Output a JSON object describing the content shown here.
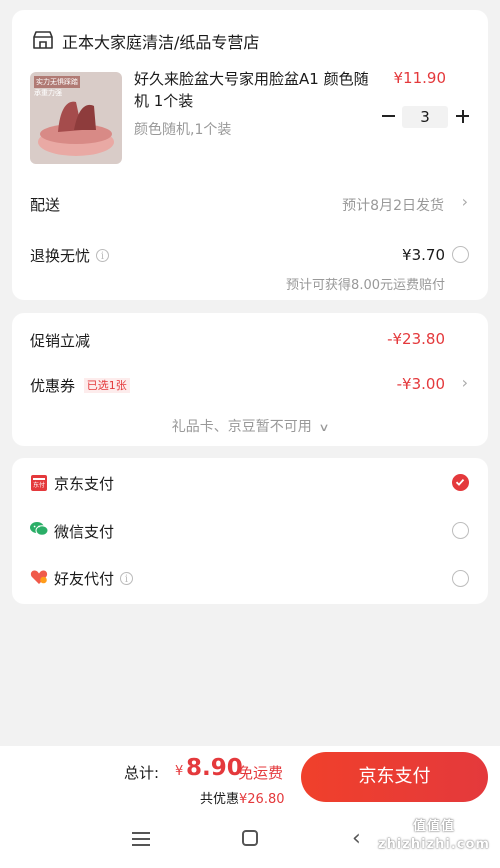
{
  "store": {
    "name": "正本大家庭清洁/纸品专营店"
  },
  "product": {
    "title": "好久来脸盆大号家用脸盆A1 颜色随机 1个装",
    "spec": "颜色随机,1个装",
    "price": "¥11.90",
    "quantity": "3",
    "thumb_text_1": "实力无惧踩踏",
    "thumb_text_2": "承重力强"
  },
  "delivery": {
    "label": "配送",
    "value": "预计8月2日发货"
  },
  "returns": {
    "label": "退换无忧",
    "price": "¥3.70",
    "note": "预计可获得8.00元运费赔付"
  },
  "discounts": {
    "promo_label": "促销立减",
    "promo_value": "-¥23.80",
    "coupon_label": "优惠券",
    "coupon_badge": "已选1张",
    "coupon_value": "-¥3.00",
    "giftcard_note": "礼品卡、京豆暂不可用"
  },
  "payment": {
    "methods": [
      {
        "label": "京东支付",
        "selected": true,
        "icon": "jd-pay-icon"
      },
      {
        "label": "微信支付",
        "selected": false,
        "icon": "wechat-icon"
      },
      {
        "label": "好友代付",
        "selected": false,
        "icon": "friend-pay-icon"
      }
    ]
  },
  "footer": {
    "total_label": "总计:",
    "total_symbol": "¥",
    "total_value": "8.90",
    "shipping": "免运费",
    "saved_label": "共优惠",
    "saved_value": "¥26.80",
    "pay_button": "京东支付"
  },
  "watermark": "值值值 zhizhizhi.com",
  "colors": {
    "accent": "#e4393c",
    "background": "#f2f2f2"
  }
}
